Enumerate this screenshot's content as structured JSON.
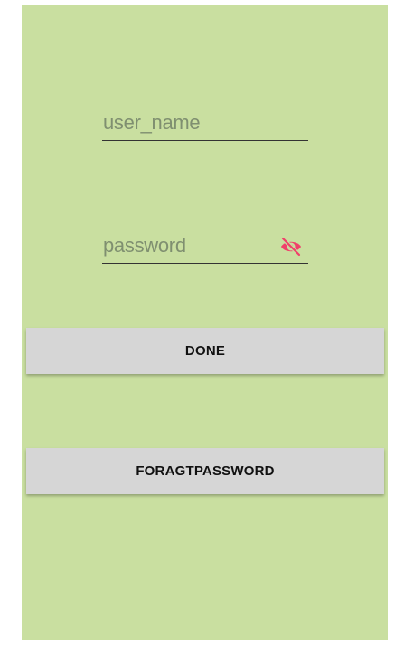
{
  "login_form": {
    "username_placeholder": "user_name",
    "password_placeholder": "password",
    "password_toggle_icon": "eye-slash-icon",
    "done_label": "DONE",
    "forgot_label": "FORAGTPASSWORD"
  },
  "colors": {
    "background": "#c9dfa0",
    "button_background": "#d6d6d6",
    "toggle_icon": "#f0406a",
    "underline": "#333333"
  }
}
